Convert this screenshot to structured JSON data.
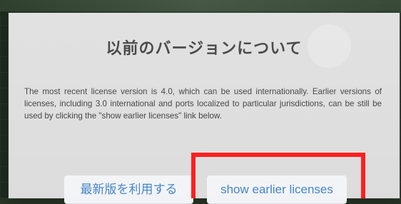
{
  "dialog": {
    "title": "以前のバージョンについて",
    "body": "The most recent license version is 4.0, which can be used internationally. Earlier versions of licenses, including 3.0 international and ports localized to particular jurisdictions, can be still be used by clicking the \"show earlier licenses\" link below."
  },
  "buttons": {
    "latest": "最新版を利用する",
    "earlier": "show earlier licenses"
  },
  "colors": {
    "highlight": "#ff1f1f",
    "button_text": "#3e80c8",
    "dialog_bg": "#dbdbdb"
  }
}
